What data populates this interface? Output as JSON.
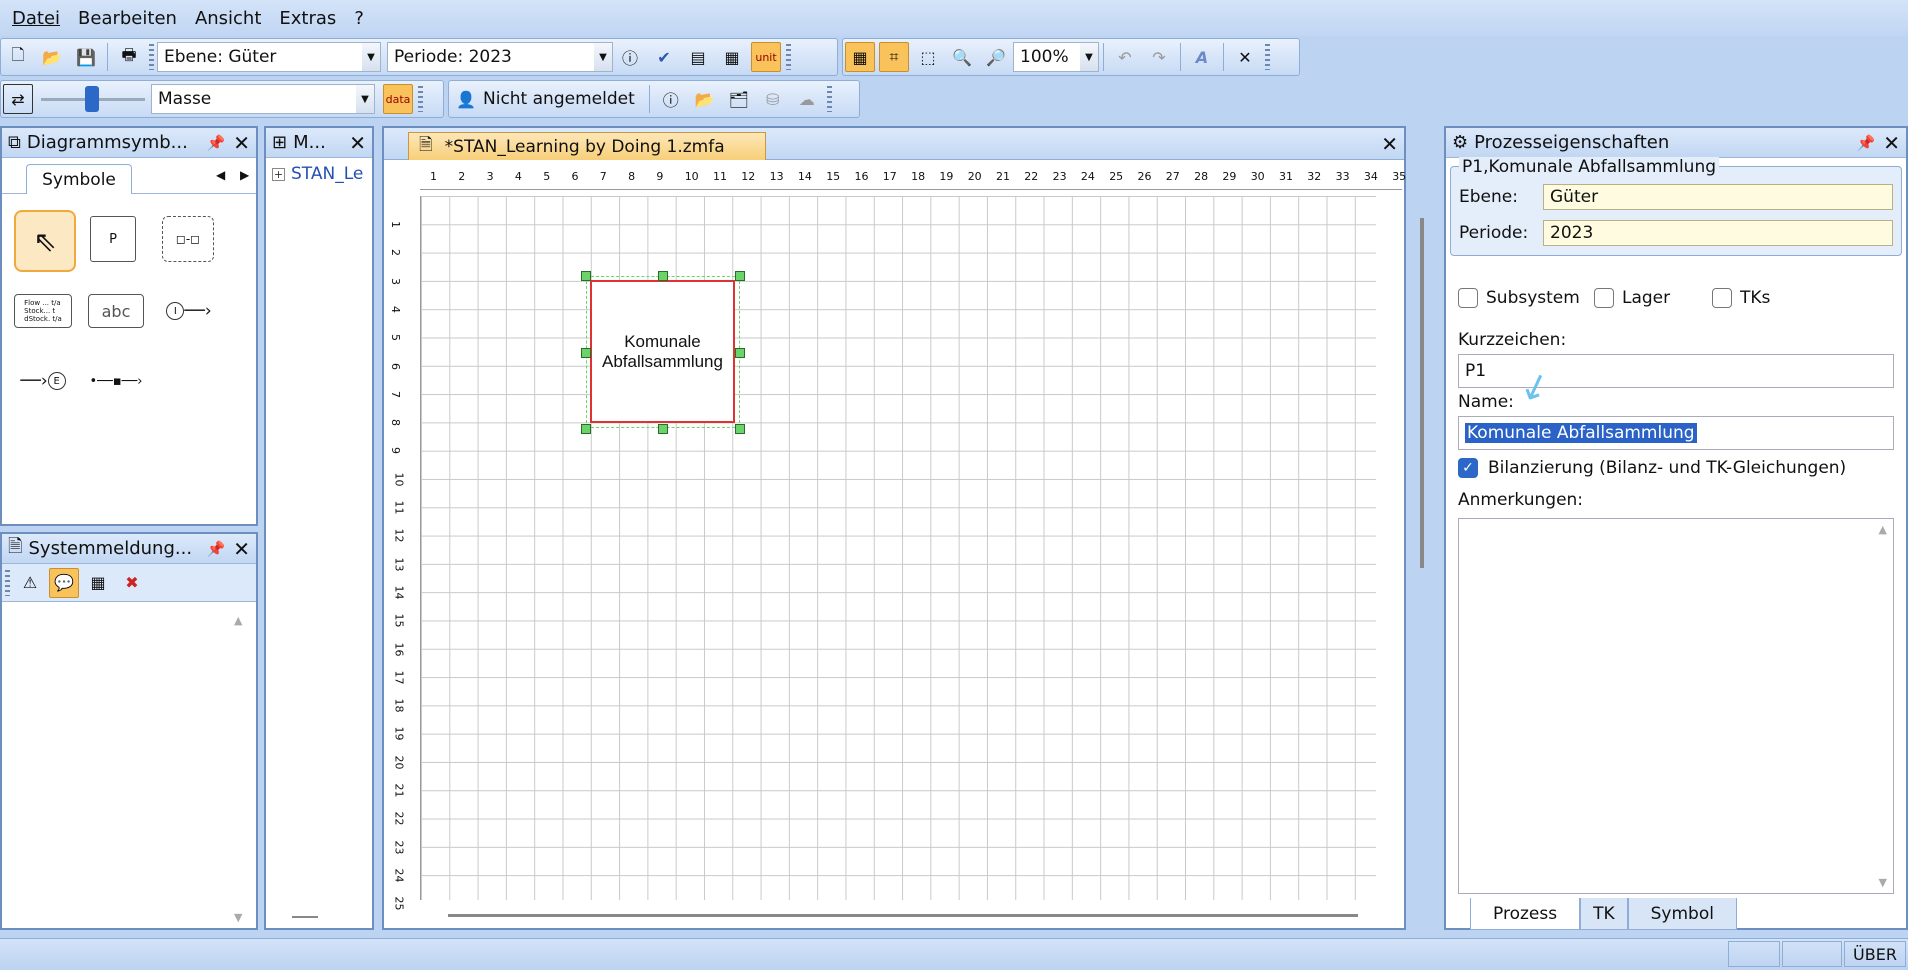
{
  "menu": [
    "Datei",
    "Bearbeiten",
    "Ansicht",
    "Extras",
    "?"
  ],
  "toolbar": {
    "ebene_combo": "Ebene: Güter",
    "periode_combo": "Periode: 2023",
    "unit_label": "unit",
    "zoom": "100%",
    "masse_combo": "Masse",
    "data_label": "data",
    "login_status": "Nicht angemeldet"
  },
  "diagram_panel": {
    "title": "Diagrammsymb...",
    "tab": "Symbole",
    "p_symbol": "P",
    "abc_symbol": "abc",
    "flow_symbol": "Flow ... t/a\nStock... t\ndStock. t/a",
    "i_symbol": "I",
    "e_symbol": "E"
  },
  "model_panel": {
    "title": "M...",
    "tree_item": "STAN_Le"
  },
  "system_panel": {
    "title": "Systemmeldung..."
  },
  "document": {
    "tab": "*STAN_Learning by Doing 1.zmfa",
    "ruler_top": [
      "1",
      "2",
      "3",
      "4",
      "5",
      "6",
      "7",
      "8",
      "9",
      "10",
      "11",
      "12",
      "13",
      "14",
      "15",
      "16",
      "17",
      "18",
      "19",
      "20",
      "21",
      "22",
      "23",
      "24",
      "25",
      "26",
      "27",
      "28",
      "29",
      "30",
      "31",
      "32",
      "33",
      "34",
      "35"
    ],
    "ruler_left": [
      "1",
      "2",
      "3",
      "4",
      "5",
      "6",
      "7",
      "8",
      "9",
      "10",
      "11",
      "12",
      "13",
      "14",
      "15",
      "16",
      "17",
      "18",
      "19",
      "20",
      "21",
      "22",
      "23",
      "24",
      "25"
    ],
    "process_label": "Komunale\nAbfallsammlung"
  },
  "properties": {
    "title": "Prozesseigenschaften",
    "group_title": "P1,Komunale Abfallsammlung",
    "ebene_label": "Ebene:",
    "ebene_value": "Güter",
    "periode_label": "Periode:",
    "periode_value": "2023",
    "subsystem": "Subsystem",
    "lager": "Lager",
    "tks": "TKs",
    "kurzzeichen_label": "Kurzzeichen:",
    "kurzzeichen_value": "P1",
    "name_label": "Name:",
    "name_value": "Komunale Abfallsammlung",
    "bilanz_label": "Bilanzierung (Bilanz- und TK-Gleichungen)",
    "anmerkungen_label": "Anmerkungen:",
    "tabs": [
      "Prozess",
      "TK",
      "Symbol"
    ]
  },
  "status": {
    "mode": "ÜBER"
  }
}
